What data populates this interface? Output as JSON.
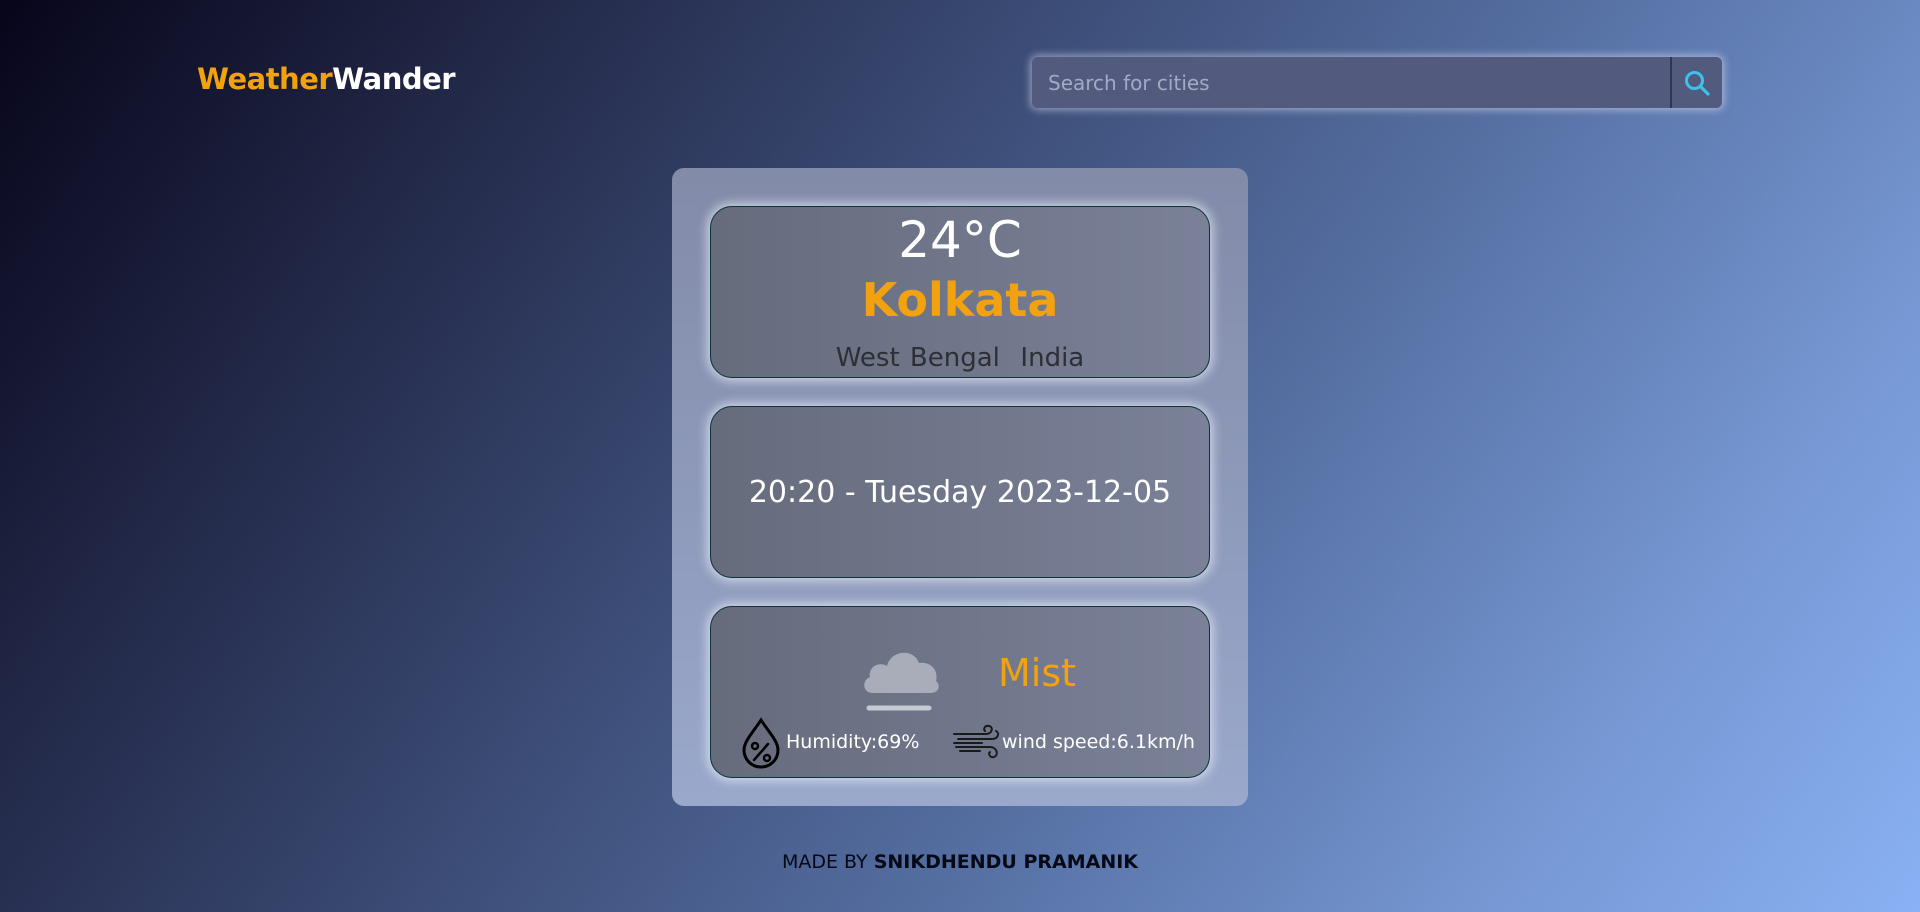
{
  "header": {
    "logo_part1": "Weather",
    "logo_part2": "Wander",
    "colors": {
      "accent": "#f3a20f",
      "text": "#ffffff"
    }
  },
  "search": {
    "placeholder": "Search for cities",
    "value": "",
    "button_icon": "search-icon"
  },
  "weather": {
    "temperature": "24°C",
    "city": "Kolkata",
    "region": "West Bengal  India",
    "datetime": "20:20 - Tuesday 2023-12-05",
    "condition": "Mist",
    "condition_icon": "mist-cloud-icon",
    "humidity": "Humidity:69%",
    "humidity_icon": "humidity-drop-icon",
    "wind": "wind speed:6.1km/h",
    "wind_icon": "wind-icon"
  },
  "footer": {
    "prefix": "MADE BY ",
    "author": "SNIKDHENDU PRAMANIK"
  }
}
